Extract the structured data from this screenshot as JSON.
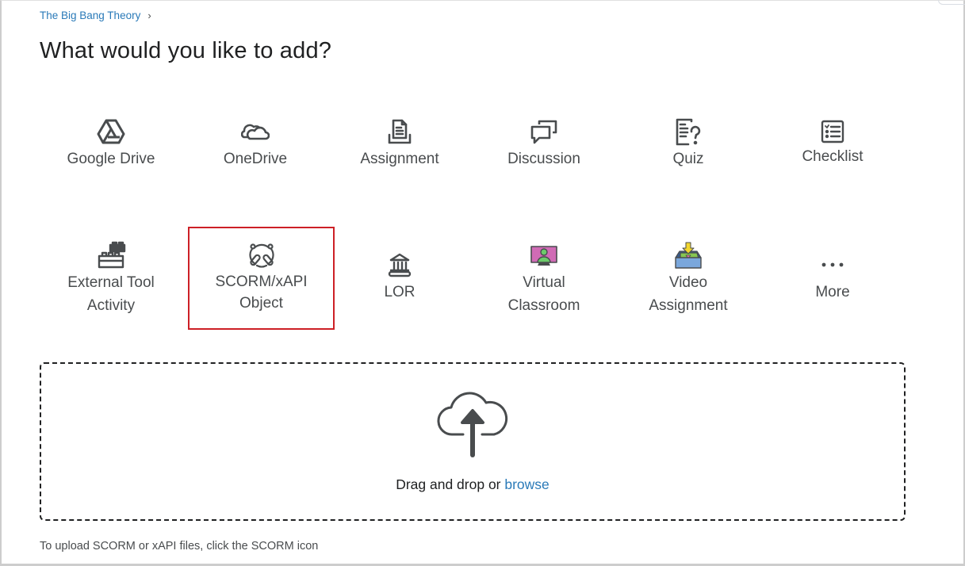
{
  "breadcrumb": {
    "items": [
      {
        "label": "The Big Bang Theory"
      }
    ],
    "separator": "›"
  },
  "page_title": "What would you like to add?",
  "tiles": [
    {
      "id": "google-drive",
      "label_lines": [
        "Google Drive"
      ],
      "icon": "google-drive-icon"
    },
    {
      "id": "onedrive",
      "label_lines": [
        "OneDrive"
      ],
      "icon": "onedrive-icon"
    },
    {
      "id": "assignment",
      "label_lines": [
        "Assignment"
      ],
      "icon": "assignment-icon"
    },
    {
      "id": "discussion",
      "label_lines": [
        "Discussion"
      ],
      "icon": "discussion-icon"
    },
    {
      "id": "quiz",
      "label_lines": [
        "Quiz"
      ],
      "icon": "quiz-icon"
    },
    {
      "id": "checklist",
      "label_lines": [
        "Checklist"
      ],
      "icon": "checklist-icon"
    },
    {
      "id": "external-tool-activity",
      "label_lines": [
        "External Tool",
        "Activity"
      ],
      "icon": "lego-brick-icon"
    },
    {
      "id": "scorm-xapi-object",
      "label_lines": [
        "SCORM/xAPI",
        "Object"
      ],
      "icon": "scorm-icon",
      "selected": true
    },
    {
      "id": "lor",
      "label_lines": [
        "LOR"
      ],
      "icon": "library-building-icon"
    },
    {
      "id": "virtual-classroom",
      "label_lines": [
        "Virtual",
        "Classroom"
      ],
      "icon": "monitor-person-icon"
    },
    {
      "id": "video-assignment",
      "label_lines": [
        "Video",
        "Assignment"
      ],
      "icon": "video-dropbox-icon"
    },
    {
      "id": "more",
      "label_lines": [
        "More"
      ],
      "icon": "ellipsis-icon"
    }
  ],
  "dropzone": {
    "text": "Drag and drop or ",
    "link": "browse",
    "icon": "cloud-upload-icon"
  },
  "hint": "To upload SCORM or xAPI files, click the SCORM icon",
  "colors": {
    "link": "#2a7ab8",
    "selected_border": "#cd2026",
    "icon": "#494c4e",
    "virtual_classroom_screen": "#d06bb5",
    "virtual_classroom_person": "#6ccb6a",
    "video_assignment_box": "#7aa7dc",
    "video_assignment_arrow": "#f2d62e"
  }
}
